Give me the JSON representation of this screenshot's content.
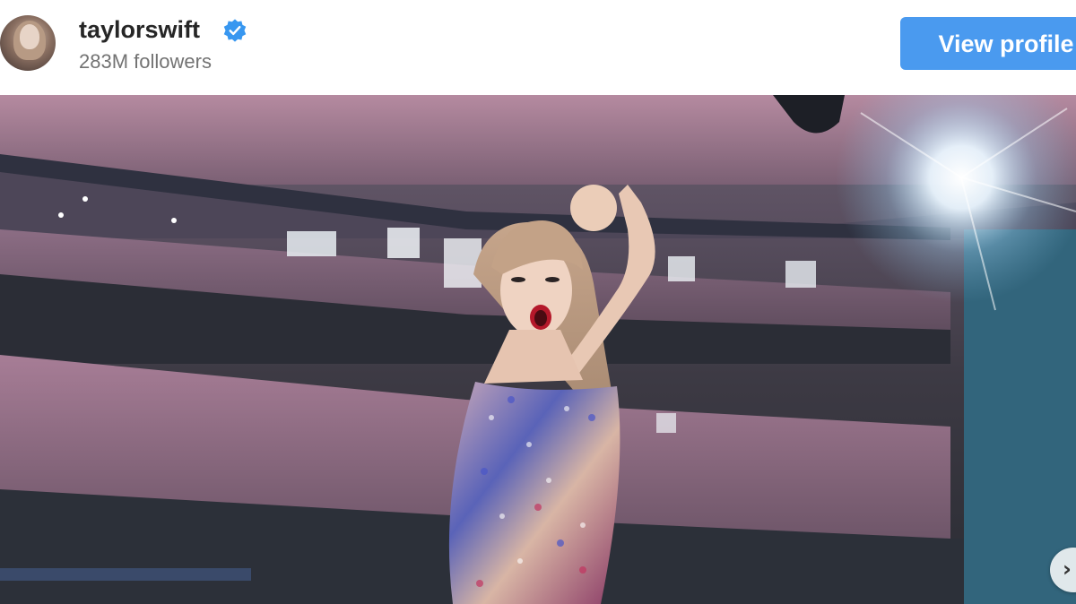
{
  "post": {
    "username": "taylorswift",
    "followers": "283M followers",
    "view_profile_label": "View profile"
  },
  "icons": {
    "verified": "verified-badge-icon",
    "next": "chevron-right-icon"
  },
  "colors": {
    "accent": "#4a9aef",
    "verified": "#3897f0",
    "username": "#262626",
    "secondary_text": "#737373"
  },
  "carousel": {
    "next_glyph": "›"
  }
}
